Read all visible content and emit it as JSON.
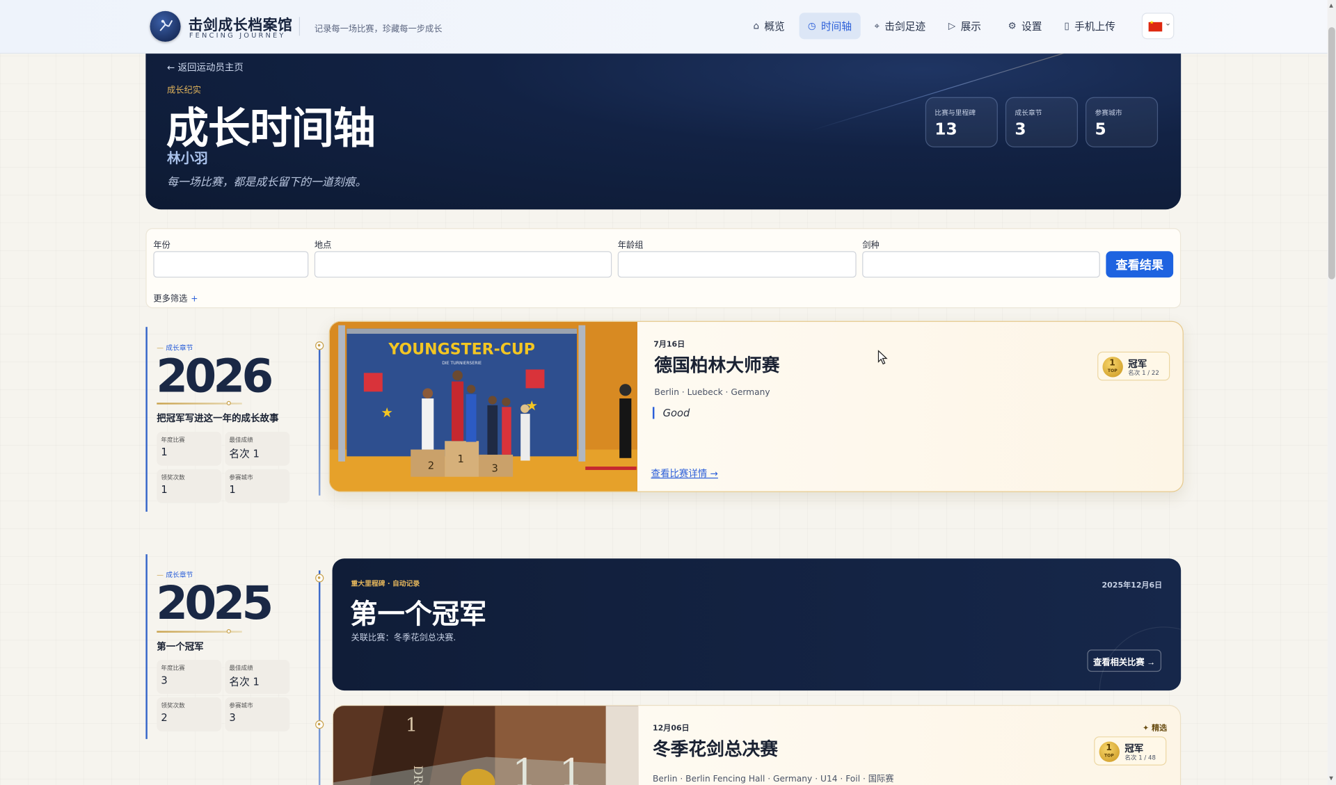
{
  "nav": {
    "brand_title": "击剑成长档案馆",
    "brand_subtitle": "FENCING JOURNEY",
    "tagline": "记录每一场比赛，珍藏每一步成长",
    "items": [
      {
        "label": "概览",
        "icon": "home-icon"
      },
      {
        "label": "时间轴",
        "icon": "clock-icon",
        "active": true
      },
      {
        "label": "击剑足迹",
        "icon": "map-pin-icon"
      },
      {
        "label": "展示",
        "icon": "play-icon"
      },
      {
        "label": "设置",
        "icon": "gear-icon"
      },
      {
        "label": "手机上传",
        "icon": "phone-icon"
      }
    ],
    "language_flag": "china-flag-icon"
  },
  "hero": {
    "back_link": "← 返回运动员主页",
    "kicker": "成长纪实",
    "title": "成长时间轴",
    "athlete_name": "林小羽",
    "quote": "每一场比赛，都是成长留下的一道刻痕。",
    "stats": [
      {
        "label": "比赛与里程碑",
        "value": "13"
      },
      {
        "label": "成长章节",
        "value": "3"
      },
      {
        "label": "参赛城市",
        "value": "5"
      }
    ]
  },
  "filters": {
    "year_label": "年份",
    "location_label": "地点",
    "age_group_label": "年龄组",
    "weapon_label": "剑种",
    "year_value": "",
    "location_value": "",
    "age_group_value": "",
    "weapon_value": "",
    "submit_label": "查看结果",
    "more_label": "更多筛选",
    "more_icon": "+"
  },
  "chapters": [
    {
      "kicker": "成长章节",
      "year": "2026",
      "description": "把冠军写进这一年的成长故事",
      "stats": [
        {
          "label": "年度比赛",
          "value": "1"
        },
        {
          "label": "最佳成绩",
          "value": "名次 1"
        },
        {
          "label": "领奖次数",
          "value": "1"
        },
        {
          "label": "参赛城市",
          "value": "1"
        }
      ]
    },
    {
      "kicker": "成长章节",
      "year": "2025",
      "description": "第一个冠军",
      "stats": [
        {
          "label": "年度比赛",
          "value": "3"
        },
        {
          "label": "最佳成绩",
          "value": "名次 1"
        },
        {
          "label": "领奖次数",
          "value": "2"
        },
        {
          "label": "参赛城市",
          "value": "3"
        }
      ]
    }
  ],
  "events": {
    "berlin_masters": {
      "date": "7月16日",
      "title": "德国柏林大师赛",
      "location": "Berlin · Luebeck · Germany",
      "note": "Good",
      "link": "查看比赛详情 →",
      "badge_title": "冠军",
      "badge_sub": "名次 1 / 22",
      "medal_number": "1",
      "medal_text": "TOP",
      "photo_banner": "YOUNGSTER-CUP",
      "photo_banner_sub": "DIE TURNIERSERIE"
    },
    "milestone": {
      "kicker": "重大里程碑 · 自动记录",
      "date": "2025年12月6日",
      "title": "第一个冠军",
      "subtitle": "关联比赛：冬季花剑总决赛.",
      "button": "查看相关比赛 →"
    },
    "winter_finals": {
      "date": "12月06日",
      "title": "冬季花剑总决赛",
      "location": "Berlin · Berlin Fencing Hall · Germany · U14 · Foil · 国际赛",
      "pick": "✦ 精选",
      "badge_title": "冠军",
      "badge_sub": "名次 1 / 48",
      "medal_number": "1",
      "medal_text": "TOP"
    }
  },
  "colors": {
    "accent_blue": "#1e63e0",
    "gold": "#c9a24c",
    "hero_navy": "#0d1a33"
  }
}
